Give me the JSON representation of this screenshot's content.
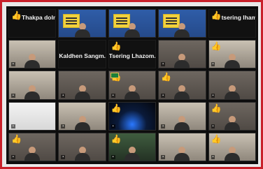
{
  "colors": {
    "frame_border": "#c8202a",
    "tile_dark": "#1a1a1a",
    "raised_hand": "#f2c94c"
  },
  "participants": {
    "row1": [
      {
        "name": "Thakpa dolma",
        "raised_hand": true
      },
      {
        "name": "",
        "raised_hand": false
      },
      {
        "name": "",
        "raised_hand": false
      },
      {
        "name": "",
        "raised_hand": false
      },
      {
        "name": "tsering lhamo",
        "raised_hand": true
      }
    ],
    "row2": [
      {
        "name": "",
        "raised_hand": false
      },
      {
        "name": "Kaldhen  Sangm...",
        "raised_hand": false
      },
      {
        "name": "Tsering  Lhazom...",
        "raised_hand": true
      },
      {
        "name": "",
        "raised_hand": false
      },
      {
        "name": "",
        "raised_hand": true
      }
    ],
    "row3": [
      {
        "name": "",
        "raised_hand": false
      },
      {
        "name": "",
        "raised_hand": false
      },
      {
        "name": "",
        "raised_hand": true
      },
      {
        "name": "",
        "raised_hand": true
      },
      {
        "name": "",
        "raised_hand": false
      }
    ],
    "row4": [
      {
        "name": "",
        "raised_hand": false
      },
      {
        "name": "",
        "raised_hand": false
      },
      {
        "name": "",
        "raised_hand": true
      },
      {
        "name": "",
        "raised_hand": false
      },
      {
        "name": "",
        "raised_hand": true
      }
    ],
    "row5": [
      {
        "name": "",
        "raised_hand": true
      },
      {
        "name": "",
        "raised_hand": false
      },
      {
        "name": "",
        "raised_hand": true
      },
      {
        "name": "",
        "raised_hand": false
      },
      {
        "name": "",
        "raised_hand": true
      }
    ]
  },
  "icons": {
    "raised_hand": "raised-hand-icon",
    "flag": "flag-icon"
  }
}
